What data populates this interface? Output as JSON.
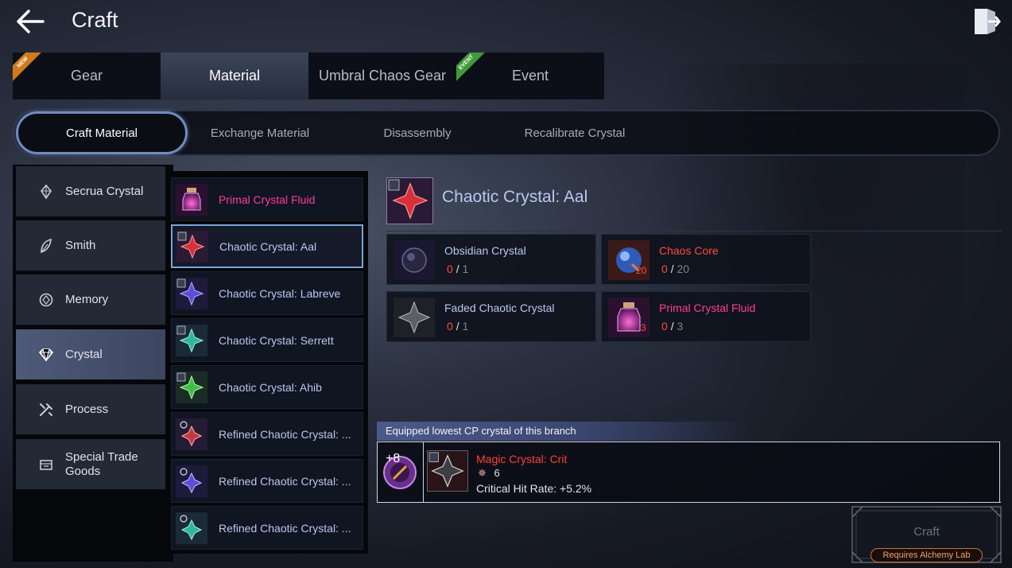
{
  "header": {
    "title": "Craft",
    "back_icon": "arrow-left-icon",
    "exit_icon": "exit-door-icon"
  },
  "main_tabs": [
    {
      "label": "Gear",
      "badge": "NEW"
    },
    {
      "label": "Material",
      "active": true
    },
    {
      "label": "Umbral Chaos Gear"
    },
    {
      "label": "Event",
      "badge": "EVENT"
    }
  ],
  "sub_tabs": [
    {
      "label": "Craft Material",
      "active": true
    },
    {
      "label": "Exchange Material"
    },
    {
      "label": "Disassembly"
    },
    {
      "label": "Recalibrate Crystal"
    }
  ],
  "categories": [
    {
      "label": "Secrua Crystal",
      "icon": "crystal-icon"
    },
    {
      "label": "Smith",
      "icon": "feather-icon"
    },
    {
      "label": "Memory",
      "icon": "memory-icon"
    },
    {
      "label": "Crystal",
      "icon": "diamond-icon",
      "active": true
    },
    {
      "label": "Process",
      "icon": "tools-icon"
    },
    {
      "label": "Special Trade Goods",
      "icon": "trade-goods-icon"
    }
  ],
  "items": [
    {
      "label": "Primal Crystal Fluid",
      "color": "#ff3d9a"
    },
    {
      "label": "Chaotic Crystal: Aal",
      "selected": true
    },
    {
      "label": "Chaotic Crystal: Labreve"
    },
    {
      "label": "Chaotic Crystal: Serrett"
    },
    {
      "label": "Chaotic Crystal: Ahib"
    },
    {
      "label": "Refined Chaotic Crystal: ..."
    },
    {
      "label": "Refined Chaotic Crystal: ..."
    },
    {
      "label": "Refined Chaotic Crystal: ..."
    }
  ],
  "detail": {
    "title": "Chaotic Crystal: Aal",
    "materials": [
      {
        "name": "Obsidian Crystal",
        "have": "0",
        "need": "1",
        "color": "#b9c8f0"
      },
      {
        "name": "Chaos Core",
        "have": "0",
        "need": "20",
        "stack": "20",
        "color": "#ff4b3c"
      },
      {
        "name": "Faded Chaotic Crystal",
        "have": "0",
        "need": "1",
        "color": "#b9c8f0"
      },
      {
        "name": "Primal Crystal Fluid",
        "have": "0",
        "need": "3",
        "stack": "3",
        "color": "#ff3d9a"
      }
    ]
  },
  "equipped": {
    "heading": "Equipped lowest CP crystal of this branch",
    "slot_level": "+8",
    "name": "Magic Crystal: Crit",
    "level": "6",
    "stat": "Critical Hit Rate: +5.2%"
  },
  "craft": {
    "label": "Craft",
    "requirement": "Requires Alchemy Lab"
  }
}
